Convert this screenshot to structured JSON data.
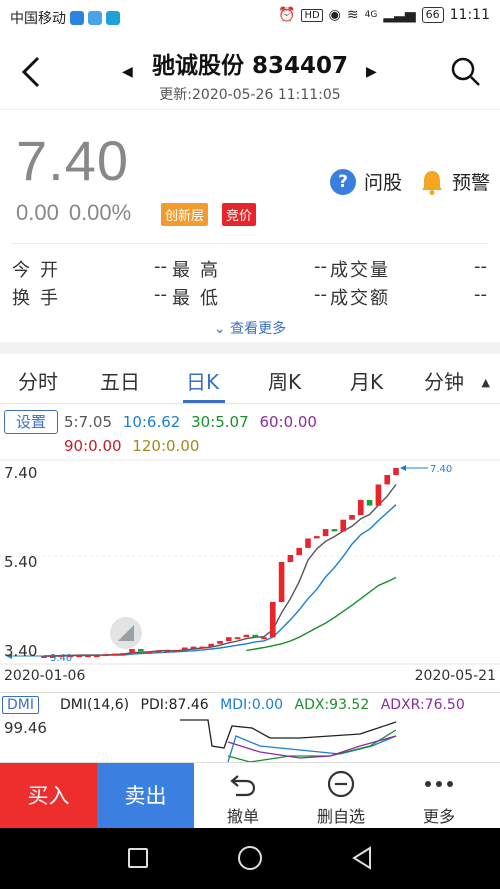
{
  "status_bar": {
    "carrier": "中国移动",
    "battery": "66",
    "time": "11:11",
    "network": "4G",
    "hd": "HD"
  },
  "header": {
    "title": "驰诚股份 834407",
    "updated": "更新:2020-05-26 11:11:05"
  },
  "quote": {
    "price": "7.40",
    "change": "0.00",
    "change_pct": "0.00%",
    "tag_layer": "创新层",
    "tag_auction": "竞价",
    "ask_label": "问股",
    "alert_label": "预警"
  },
  "grid": {
    "row1": [
      {
        "label": "今开",
        "value": "--"
      },
      {
        "label": "最高",
        "value": "--"
      },
      {
        "label": "成交量",
        "value": "--"
      }
    ],
    "row2": [
      {
        "label": "换手",
        "value": "--"
      },
      {
        "label": "最低",
        "value": "--"
      },
      {
        "label": "成交额",
        "value": "--"
      }
    ],
    "more": "查看更多"
  },
  "tabs": [
    "分时",
    "五日",
    "日K",
    "周K",
    "月K",
    "分钟"
  ],
  "ma": {
    "settings": "设置",
    "ma5": "5:7.05",
    "ma10": "10:6.62",
    "ma30": "30:5.07",
    "ma60": "60:0.00",
    "ma90": "90:0.00",
    "ma120": "120:0.00"
  },
  "colors": {
    "up": "#e8252a",
    "down": "#1a9e3c",
    "ma5": "#555555",
    "ma10": "#1a7fd0",
    "ma30": "#1a8f2a",
    "ma60": "#8a2ba0",
    "ma90": "#c2202a",
    "ma120": "#a38a1a",
    "accent": "#3b6fc6"
  },
  "chart_data": {
    "type": "candlestick",
    "y_axis_labels": [
      "7.40",
      "5.40",
      "3.40"
    ],
    "ylim": [
      3.4,
      7.4
    ],
    "x_start_label": "2020-01-06",
    "x_end_label": "2020-05-21",
    "max_marker": "7.40",
    "min_marker": "3.40",
    "candles_close": [
      3.4,
      3.4,
      3.42,
      3.42,
      3.42,
      3.42,
      3.42,
      3.44,
      3.45,
      3.46,
      3.55,
      3.5,
      3.5,
      3.52,
      3.52,
      3.53,
      3.58,
      3.6,
      3.6,
      3.66,
      3.72,
      3.8,
      3.8,
      3.85,
      3.8,
      3.8,
      4.55,
      5.4,
      5.55,
      5.7,
      5.9,
      5.95,
      6.1,
      6.05,
      6.3,
      6.4,
      6.72,
      6.6,
      7.05,
      7.25,
      7.4
    ],
    "ma5": [
      3.4,
      3.4,
      3.41,
      3.41,
      3.42,
      3.42,
      3.42,
      3.42,
      3.43,
      3.44,
      3.47,
      3.48,
      3.49,
      3.51,
      3.52,
      3.51,
      3.53,
      3.55,
      3.57,
      3.59,
      3.63,
      3.68,
      3.72,
      3.77,
      3.8,
      3.81,
      3.96,
      4.32,
      4.62,
      4.98,
      5.44,
      5.68,
      5.84,
      5.94,
      6.06,
      6.16,
      6.32,
      6.41,
      6.61,
      6.8,
      7.05
    ],
    "ma10": [
      3.4,
      3.4,
      3.4,
      3.41,
      3.41,
      3.41,
      3.42,
      3.42,
      3.42,
      3.42,
      3.44,
      3.45,
      3.46,
      3.47,
      3.48,
      3.49,
      3.5,
      3.51,
      3.53,
      3.55,
      3.57,
      3.6,
      3.63,
      3.66,
      3.7,
      3.72,
      3.8,
      3.98,
      4.17,
      4.38,
      4.62,
      4.82,
      5.08,
      5.28,
      5.52,
      5.78,
      5.98,
      6.1,
      6.28,
      6.45,
      6.62
    ],
    "ma30_from_index": 23,
    "ma30": [
      3.52,
      3.55,
      3.58,
      3.62,
      3.66,
      3.72,
      3.8,
      3.9,
      4.0,
      4.1,
      4.22,
      4.35,
      4.48,
      4.62,
      4.76,
      4.9,
      4.98,
      5.07
    ]
  },
  "dmi": {
    "button": "DMI",
    "params": "DMI(14,6)",
    "pdi": "PDI:87.46",
    "mdi": "MDI:0.00",
    "adx": "ADX:93.52",
    "adxr": "ADXR:76.50",
    "y_top": "99.46",
    "colors": {
      "pdi": "#222222",
      "mdi": "#1a7fd0",
      "adx": "#1a8f2a",
      "adxr": "#8a2ba0"
    }
  },
  "actions": {
    "buy": "买入",
    "sell": "卖出",
    "cancel": "撤单",
    "remove_fav": "删自选",
    "more": "更多"
  }
}
